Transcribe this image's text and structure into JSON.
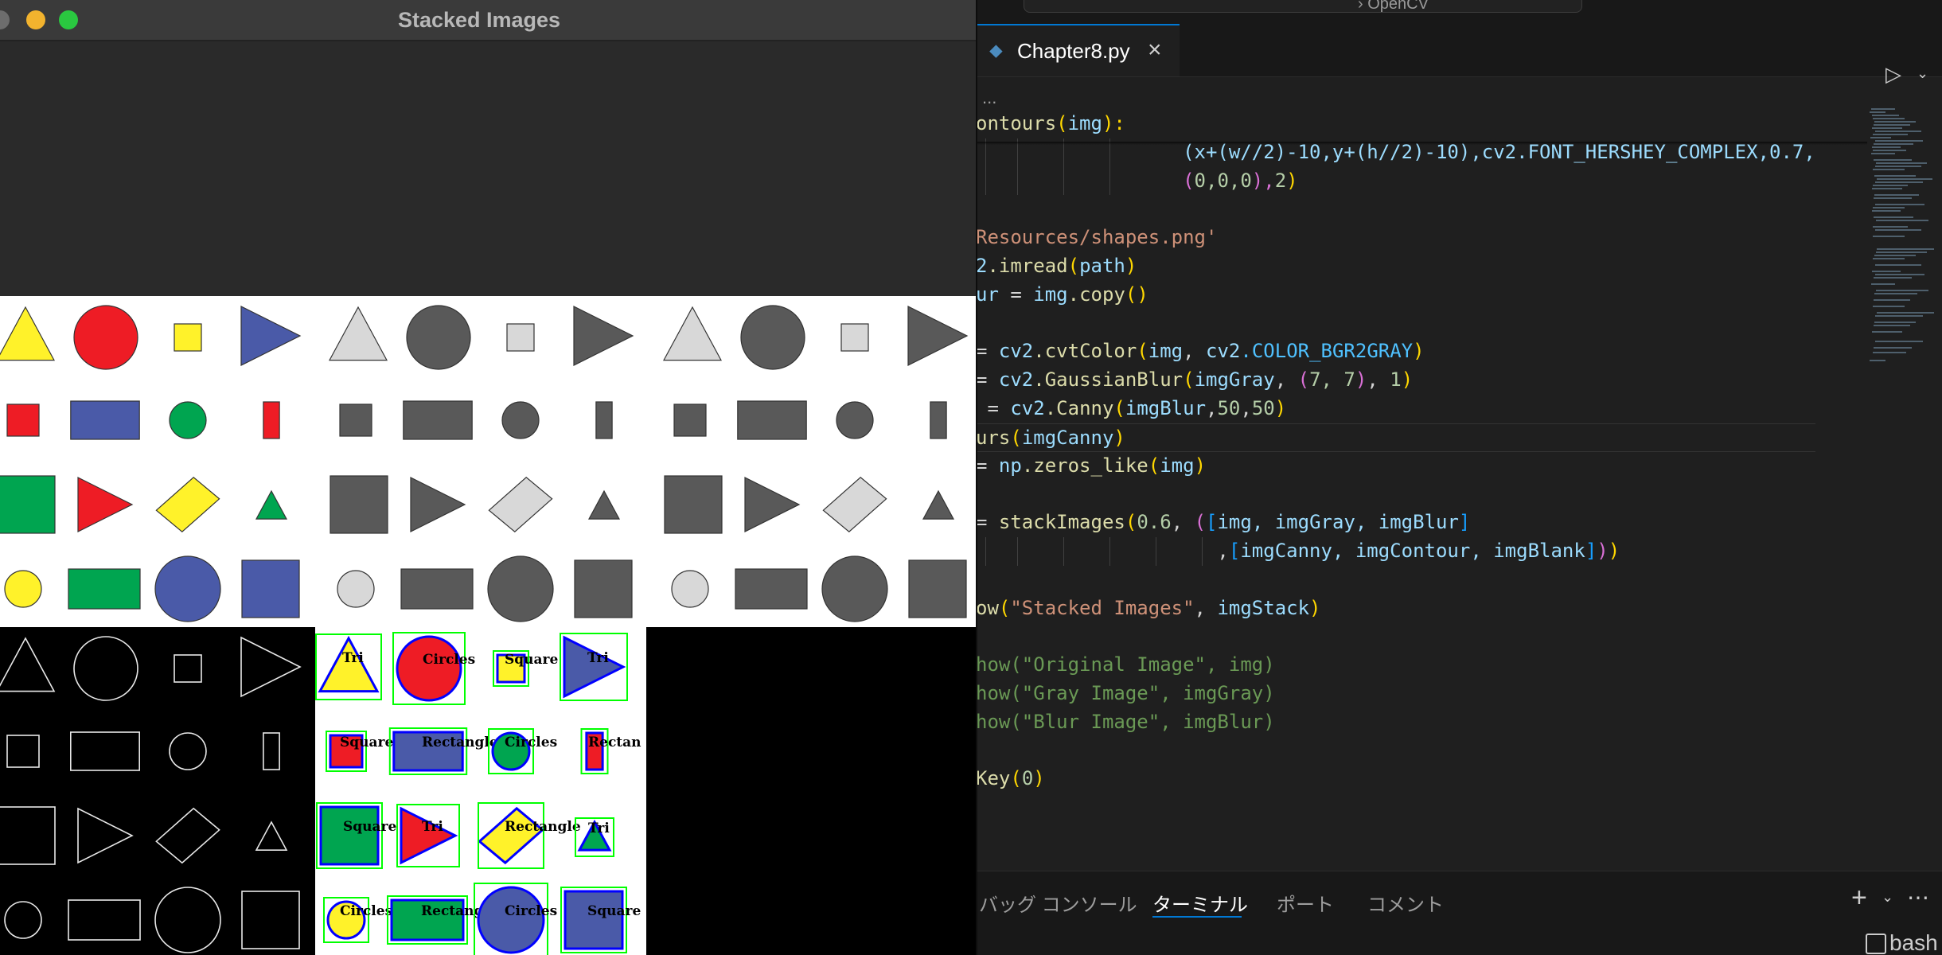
{
  "window": {
    "title": "Stacked Images"
  },
  "editor": {
    "tab_label": "Chapter8.py",
    "breadcrumb": "...",
    "command_center_text": "› OpenCV",
    "code_lines": [
      [
        {
          "t": "ontours",
          "c": "k"
        },
        {
          "t": "(",
          "c": "y"
        },
        {
          "t": "img",
          "c": "v"
        },
        {
          "t": "):",
          "c": "y"
        }
      ],
      [
        {
          "t": "                  (x+(w//2)-10,y+(h//2)-10),cv2.FONT_HERSHEY_COMPLEX,0.7,",
          "c": "v"
        }
      ],
      [
        {
          "t": "                  ",
          "c": "p"
        },
        {
          "t": "(",
          "c": "m"
        },
        {
          "t": "0,0,0",
          "c": "n"
        },
        {
          "t": "),",
          "c": "m"
        },
        {
          "t": "2",
          "c": "n"
        },
        {
          "t": ")",
          "c": "y"
        }
      ],
      [
        {
          "t": "",
          "c": "p"
        }
      ],
      [
        {
          "t": "Resources/shapes.png'",
          "c": "s"
        }
      ],
      [
        {
          "t": "2",
          "c": "v"
        },
        {
          "t": ".imread",
          "c": "k"
        },
        {
          "t": "(",
          "c": "y"
        },
        {
          "t": "path",
          "c": "v"
        },
        {
          "t": ")",
          "c": "y"
        }
      ],
      [
        {
          "t": "ur ",
          "c": "v"
        },
        {
          "t": "= ",
          "c": "p"
        },
        {
          "t": "img",
          "c": "v"
        },
        {
          "t": ".copy",
          "c": "k"
        },
        {
          "t": "()",
          "c": "y"
        }
      ],
      [
        {
          "t": "",
          "c": "p"
        }
      ],
      [
        {
          "t": "= ",
          "c": "p"
        },
        {
          "t": "cv2",
          "c": "v"
        },
        {
          "t": ".cvtColor",
          "c": "k"
        },
        {
          "t": "(",
          "c": "y"
        },
        {
          "t": "img",
          "c": "v"
        },
        {
          "t": ", ",
          "c": "p"
        },
        {
          "t": "cv2",
          "c": "v"
        },
        {
          "t": ".COLOR_BGR2GRAY",
          "c": "c"
        },
        {
          "t": ")",
          "c": "y"
        }
      ],
      [
        {
          "t": "= ",
          "c": "p"
        },
        {
          "t": "cv2",
          "c": "v"
        },
        {
          "t": ".GaussianBlur",
          "c": "k"
        },
        {
          "t": "(",
          "c": "y"
        },
        {
          "t": "imgGray",
          "c": "v"
        },
        {
          "t": ", ",
          "c": "p"
        },
        {
          "t": "(",
          "c": "m"
        },
        {
          "t": "7, 7",
          "c": "n"
        },
        {
          "t": ")",
          "c": "m"
        },
        {
          "t": ", ",
          "c": "p"
        },
        {
          "t": "1",
          "c": "n"
        },
        {
          "t": ")",
          "c": "y"
        }
      ],
      [
        {
          "t": " = ",
          "c": "p"
        },
        {
          "t": "cv2",
          "c": "v"
        },
        {
          "t": ".Canny",
          "c": "k"
        },
        {
          "t": "(",
          "c": "y"
        },
        {
          "t": "imgBlur",
          "c": "v"
        },
        {
          "t": ",",
          "c": "p"
        },
        {
          "t": "50",
          "c": "n"
        },
        {
          "t": ",",
          "c": "p"
        },
        {
          "t": "50",
          "c": "n"
        },
        {
          "t": ")",
          "c": "y"
        }
      ],
      [
        {
          "t": "urs",
          "c": "k"
        },
        {
          "t": "(",
          "c": "y"
        },
        {
          "t": "imgCanny",
          "c": "v"
        },
        {
          "t": ")",
          "c": "y"
        }
      ],
      [
        {
          "t": "= ",
          "c": "p"
        },
        {
          "t": "np",
          "c": "v"
        },
        {
          "t": ".zeros_like",
          "c": "k"
        },
        {
          "t": "(",
          "c": "y"
        },
        {
          "t": "img",
          "c": "v"
        },
        {
          "t": ")",
          "c": "y"
        }
      ],
      [
        {
          "t": "",
          "c": "p"
        }
      ],
      [
        {
          "t": "= ",
          "c": "p"
        },
        {
          "t": "stackImages",
          "c": "k"
        },
        {
          "t": "(",
          "c": "y"
        },
        {
          "t": "0.6",
          "c": "n"
        },
        {
          "t": ", ",
          "c": "p"
        },
        {
          "t": "(",
          "c": "m"
        },
        {
          "t": "[",
          "c": "b"
        },
        {
          "t": "img, imgGray, imgBlur",
          "c": "v"
        },
        {
          "t": "]",
          "c": "b"
        }
      ],
      [
        {
          "t": "                     ,",
          "c": "p"
        },
        {
          "t": "[",
          "c": "b"
        },
        {
          "t": "imgCanny, imgContour, imgBlank",
          "c": "v"
        },
        {
          "t": "]",
          "c": "b"
        },
        {
          "t": ")",
          "c": "m"
        },
        {
          "t": ")",
          "c": "y"
        }
      ],
      [
        {
          "t": "",
          "c": "p"
        }
      ],
      [
        {
          "t": "ow",
          "c": "k"
        },
        {
          "t": "(",
          "c": "y"
        },
        {
          "t": "\"Stacked Images\"",
          "c": "s"
        },
        {
          "t": ", ",
          "c": "p"
        },
        {
          "t": "imgStack",
          "c": "v"
        },
        {
          "t": ")",
          "c": "y"
        }
      ],
      [
        {
          "t": "",
          "c": "p"
        }
      ],
      [
        {
          "t": "how(\"Original Image\", img)",
          "c": "g"
        }
      ],
      [
        {
          "t": "how(\"Gray Image\", imgGray)",
          "c": "g"
        }
      ],
      [
        {
          "t": "how(\"Blur Image\", imgBlur)",
          "c": "g"
        }
      ],
      [
        {
          "t": "",
          "c": "p"
        }
      ],
      [
        {
          "t": "Key",
          "c": "k"
        },
        {
          "t": "(",
          "c": "y"
        },
        {
          "t": "0",
          "c": "n"
        },
        {
          "t": ")",
          "c": "y"
        }
      ]
    ]
  },
  "panel": {
    "tabs": [
      "バッグ コンソール",
      "ターミナル",
      "ポート",
      "コメント"
    ],
    "active_tab": "ターミナル",
    "terminal_label": "bash"
  },
  "contour_labels": [
    [
      "Tri",
      "Circles",
      "Square",
      "Tri"
    ],
    [
      "Square",
      "Rectangle",
      "Circles",
      "Rectan"
    ],
    [
      "Square",
      "Tri",
      "Rectangle",
      "Tri"
    ],
    [
      "Circles",
      "Rectangle",
      "Circles",
      "Square"
    ]
  ],
  "colors": {
    "yellow": "#fff22a",
    "red": "#ee1c25",
    "blue": "#4a5aa8",
    "green": "#00a550",
    "gray_dark": "#595959",
    "gray_light": "#d8d8d8",
    "bbox": "#00ff00",
    "contour": "#0000ff"
  },
  "icons": [
    "python-file-icon",
    "close-icon",
    "run-icon",
    "chevron-down-icon",
    "plus-icon",
    "more-icon",
    "terminal-icon"
  ]
}
